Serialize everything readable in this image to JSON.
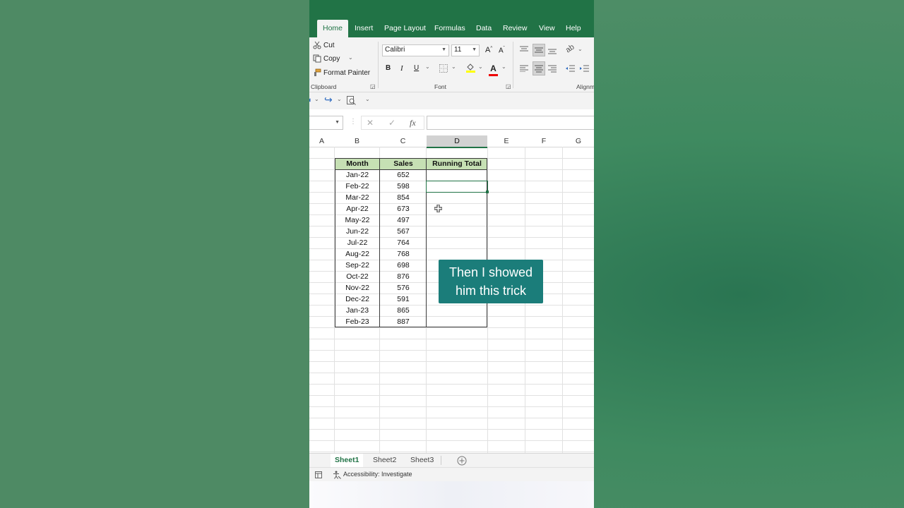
{
  "ribbon_tabs": [
    "Home",
    "Insert",
    "Page Layout",
    "Formulas",
    "Data",
    "Review",
    "View",
    "Help"
  ],
  "clipboard": {
    "cut": "Cut",
    "copy": "Copy",
    "format_painter": "Format Painter",
    "label": "Clipboard"
  },
  "font": {
    "name": "Calibri",
    "size": "11",
    "bold": "B",
    "italic": "I",
    "underline": "U",
    "label": "Font",
    "color_letter": "A",
    "grow": "A",
    "shrink": "A"
  },
  "alignment": {
    "label": "Alignm"
  },
  "formula_bar": {
    "fx": "fx",
    "content": ""
  },
  "columns": [
    "A",
    "B",
    "C",
    "D",
    "E",
    "F",
    "G"
  ],
  "selected_column": "D",
  "table": {
    "headers": [
      "Month",
      "Sales",
      "Running Total"
    ],
    "rows": [
      {
        "month": "Jan-22",
        "sales": "652"
      },
      {
        "month": "Feb-22",
        "sales": "598"
      },
      {
        "month": "Mar-22",
        "sales": "854"
      },
      {
        "month": "Apr-22",
        "sales": "673"
      },
      {
        "month": "May-22",
        "sales": "497"
      },
      {
        "month": "Jun-22",
        "sales": "567"
      },
      {
        "month": "Jul-22",
        "sales": "764"
      },
      {
        "month": "Aug-22",
        "sales": "768"
      },
      {
        "month": "Sep-22",
        "sales": "698"
      },
      {
        "month": "Oct-22",
        "sales": "876"
      },
      {
        "month": "Nov-22",
        "sales": "576"
      },
      {
        "month": "Dec-22",
        "sales": "591"
      },
      {
        "month": "Jan-23",
        "sales": "865"
      },
      {
        "month": "Feb-23",
        "sales": "887"
      }
    ]
  },
  "caption": {
    "line1": "Then I showed",
    "line2": "him this trick"
  },
  "sheets": [
    "Sheet1",
    "Sheet2",
    "Sheet3"
  ],
  "active_sheet": "Sheet1",
  "status": {
    "accessibility": "Accessibility: Investigate"
  },
  "colors": {
    "excel_green": "#217346",
    "header_fill": "#c6e0b4",
    "caption_bg": "#1b7d7a"
  }
}
